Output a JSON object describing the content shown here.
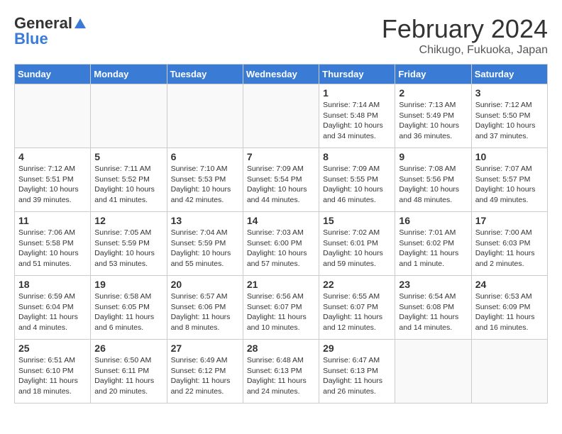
{
  "header": {
    "logo_general": "General",
    "logo_blue": "Blue",
    "month_title": "February 2024",
    "location": "Chikugo, Fukuoka, Japan"
  },
  "days_of_week": [
    "Sunday",
    "Monday",
    "Tuesday",
    "Wednesday",
    "Thursday",
    "Friday",
    "Saturday"
  ],
  "weeks": [
    [
      {
        "day": "",
        "info": ""
      },
      {
        "day": "",
        "info": ""
      },
      {
        "day": "",
        "info": ""
      },
      {
        "day": "",
        "info": ""
      },
      {
        "day": "1",
        "info": "Sunrise: 7:14 AM\nSunset: 5:48 PM\nDaylight: 10 hours\nand 34 minutes."
      },
      {
        "day": "2",
        "info": "Sunrise: 7:13 AM\nSunset: 5:49 PM\nDaylight: 10 hours\nand 36 minutes."
      },
      {
        "day": "3",
        "info": "Sunrise: 7:12 AM\nSunset: 5:50 PM\nDaylight: 10 hours\nand 37 minutes."
      }
    ],
    [
      {
        "day": "4",
        "info": "Sunrise: 7:12 AM\nSunset: 5:51 PM\nDaylight: 10 hours\nand 39 minutes."
      },
      {
        "day": "5",
        "info": "Sunrise: 7:11 AM\nSunset: 5:52 PM\nDaylight: 10 hours\nand 41 minutes."
      },
      {
        "day": "6",
        "info": "Sunrise: 7:10 AM\nSunset: 5:53 PM\nDaylight: 10 hours\nand 42 minutes."
      },
      {
        "day": "7",
        "info": "Sunrise: 7:09 AM\nSunset: 5:54 PM\nDaylight: 10 hours\nand 44 minutes."
      },
      {
        "day": "8",
        "info": "Sunrise: 7:09 AM\nSunset: 5:55 PM\nDaylight: 10 hours\nand 46 minutes."
      },
      {
        "day": "9",
        "info": "Sunrise: 7:08 AM\nSunset: 5:56 PM\nDaylight: 10 hours\nand 48 minutes."
      },
      {
        "day": "10",
        "info": "Sunrise: 7:07 AM\nSunset: 5:57 PM\nDaylight: 10 hours\nand 49 minutes."
      }
    ],
    [
      {
        "day": "11",
        "info": "Sunrise: 7:06 AM\nSunset: 5:58 PM\nDaylight: 10 hours\nand 51 minutes."
      },
      {
        "day": "12",
        "info": "Sunrise: 7:05 AM\nSunset: 5:59 PM\nDaylight: 10 hours\nand 53 minutes."
      },
      {
        "day": "13",
        "info": "Sunrise: 7:04 AM\nSunset: 5:59 PM\nDaylight: 10 hours\nand 55 minutes."
      },
      {
        "day": "14",
        "info": "Sunrise: 7:03 AM\nSunset: 6:00 PM\nDaylight: 10 hours\nand 57 minutes."
      },
      {
        "day": "15",
        "info": "Sunrise: 7:02 AM\nSunset: 6:01 PM\nDaylight: 10 hours\nand 59 minutes."
      },
      {
        "day": "16",
        "info": "Sunrise: 7:01 AM\nSunset: 6:02 PM\nDaylight: 11 hours\nand 1 minute."
      },
      {
        "day": "17",
        "info": "Sunrise: 7:00 AM\nSunset: 6:03 PM\nDaylight: 11 hours\nand 2 minutes."
      }
    ],
    [
      {
        "day": "18",
        "info": "Sunrise: 6:59 AM\nSunset: 6:04 PM\nDaylight: 11 hours\nand 4 minutes."
      },
      {
        "day": "19",
        "info": "Sunrise: 6:58 AM\nSunset: 6:05 PM\nDaylight: 11 hours\nand 6 minutes."
      },
      {
        "day": "20",
        "info": "Sunrise: 6:57 AM\nSunset: 6:06 PM\nDaylight: 11 hours\nand 8 minutes."
      },
      {
        "day": "21",
        "info": "Sunrise: 6:56 AM\nSunset: 6:07 PM\nDaylight: 11 hours\nand 10 minutes."
      },
      {
        "day": "22",
        "info": "Sunrise: 6:55 AM\nSunset: 6:07 PM\nDaylight: 11 hours\nand 12 minutes."
      },
      {
        "day": "23",
        "info": "Sunrise: 6:54 AM\nSunset: 6:08 PM\nDaylight: 11 hours\nand 14 minutes."
      },
      {
        "day": "24",
        "info": "Sunrise: 6:53 AM\nSunset: 6:09 PM\nDaylight: 11 hours\nand 16 minutes."
      }
    ],
    [
      {
        "day": "25",
        "info": "Sunrise: 6:51 AM\nSunset: 6:10 PM\nDaylight: 11 hours\nand 18 minutes."
      },
      {
        "day": "26",
        "info": "Sunrise: 6:50 AM\nSunset: 6:11 PM\nDaylight: 11 hours\nand 20 minutes."
      },
      {
        "day": "27",
        "info": "Sunrise: 6:49 AM\nSunset: 6:12 PM\nDaylight: 11 hours\nand 22 minutes."
      },
      {
        "day": "28",
        "info": "Sunrise: 6:48 AM\nSunset: 6:13 PM\nDaylight: 11 hours\nand 24 minutes."
      },
      {
        "day": "29",
        "info": "Sunrise: 6:47 AM\nSunset: 6:13 PM\nDaylight: 11 hours\nand 26 minutes."
      },
      {
        "day": "",
        "info": ""
      },
      {
        "day": "",
        "info": ""
      }
    ]
  ]
}
